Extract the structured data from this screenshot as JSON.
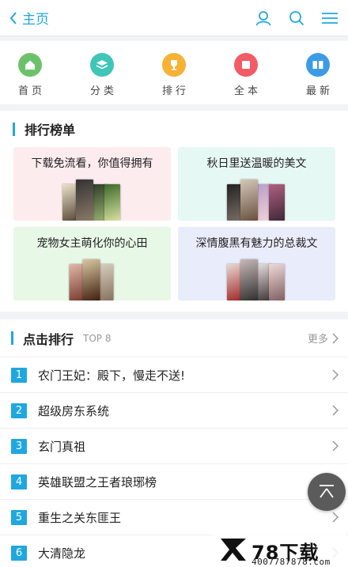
{
  "header": {
    "back_label": "主页"
  },
  "nav": [
    {
      "label": "首页",
      "icon": "home-icon",
      "color": "#6cc26b"
    },
    {
      "label": "分类",
      "icon": "layers-icon",
      "color": "#3fc6b6"
    },
    {
      "label": "排行",
      "icon": "trophy-icon",
      "color": "#f5b235"
    },
    {
      "label": "全本",
      "icon": "book-icon",
      "color": "#f35b66"
    },
    {
      "label": "最新",
      "icon": "open-book-icon",
      "color": "#3c9be6"
    }
  ],
  "ranking": {
    "title": "排行榜单",
    "cards": [
      {
        "title": "下载免流看，你值得拥有",
        "bg": "#fdecee"
      },
      {
        "title": "秋日里送温暖的美文",
        "bg": "#e6f8f4"
      },
      {
        "title": "宠物女主萌化你的心田",
        "bg": "#e7f8e6"
      },
      {
        "title": "深情腹黑有魅力的总裁文",
        "bg": "#e9ecfa"
      }
    ]
  },
  "click_rank": {
    "title": "点击排行",
    "tag": "TOP 8",
    "more": "更多",
    "items": [
      {
        "num": "1",
        "title": "农门王妃：殿下，慢走不送!"
      },
      {
        "num": "2",
        "title": "超级房东系统"
      },
      {
        "num": "3",
        "title": "玄门真祖"
      },
      {
        "num": "4",
        "title": "英雄联盟之王者琅琊榜"
      },
      {
        "num": "5",
        "title": "重生之关东匪王"
      },
      {
        "num": "6",
        "title": "大清隐龙"
      }
    ]
  },
  "watermark": {
    "brand": "78下载",
    "url": "4007787878.com"
  }
}
